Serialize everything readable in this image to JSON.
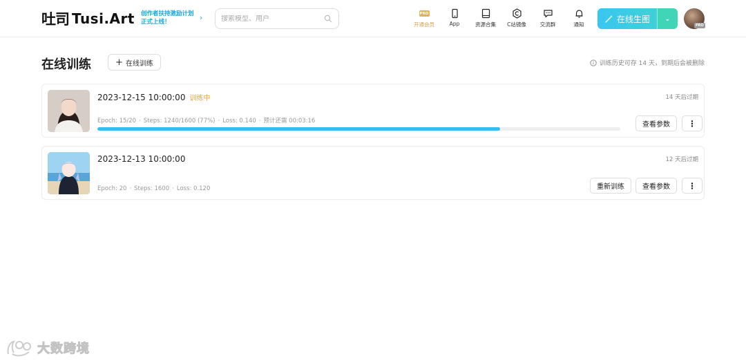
{
  "header": {
    "logo_mark": "吐司",
    "logo_text": "Tusi.Art",
    "promo_line1": "创作者扶持激励计划",
    "promo_line2": "正式上线！",
    "search_placeholder": "搜索模型、用户",
    "nav": [
      {
        "label": "开通会员",
        "icon": "pro-badge-icon",
        "badge": "PRO"
      },
      {
        "label": "App",
        "icon": "phone-icon"
      },
      {
        "label": "资源合集",
        "icon": "book-icon"
      },
      {
        "label": "C站镜像",
        "icon": "c-hexagon-icon"
      },
      {
        "label": "交流群",
        "icon": "chat-icon"
      },
      {
        "label": "通知",
        "icon": "bell-icon"
      }
    ],
    "generate_label": "在线生图",
    "avatar_badge": "PRO",
    "colors": {
      "accent": "#36bdf0",
      "accent_green": "#3fd5b6",
      "member_gold": "#d3a04a"
    }
  },
  "page": {
    "title": "在线训练",
    "new_button": "在线训练",
    "history_note": "训练历史可存 14 天，到期后会被删除"
  },
  "tasks": [
    {
      "datetime": "2023-12-15 10:00:00",
      "status": "训练中",
      "expire": "14 天后过期",
      "epoch": "Epoch: 15/20",
      "steps": "Steps: 1240/1600 (77%)",
      "loss": "Loss: 0.140",
      "eta": "预计还需 00:03:16",
      "progress": 0.77,
      "params_button": "查看参数"
    },
    {
      "datetime": "2023-12-13 10:00:00",
      "expire": "12 天后过期",
      "epoch": "Epoch: 20",
      "steps": "Steps: 1600",
      "loss": "Loss: 0.120",
      "retrain_button": "重新训练",
      "params_button": "查看参数"
    }
  ],
  "watermark": "大数跨境"
}
